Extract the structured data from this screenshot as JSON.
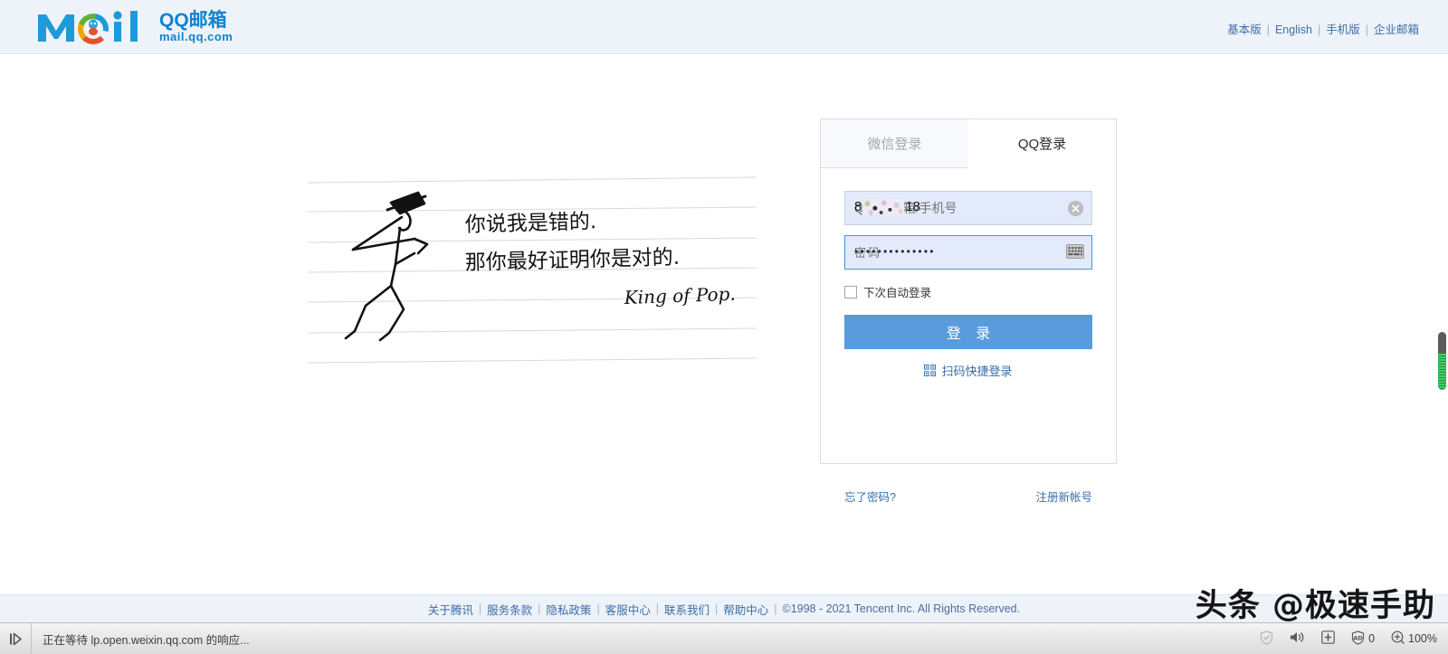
{
  "header": {
    "logo": {
      "brand_mark": "moil-logo",
      "title": "QQ邮箱",
      "subtitle": "mail.qq.com",
      "color": "#0e82d2"
    },
    "links": [
      {
        "label": "基本版",
        "name": "header-link-basic"
      },
      {
        "label": "English",
        "name": "header-link-english"
      },
      {
        "label": "手机版",
        "name": "header-link-mobile"
      },
      {
        "label": "企业邮箱",
        "name": "header-link-enterprise"
      }
    ],
    "separator": "|"
  },
  "illustration": {
    "line1": "你说我是错的.",
    "line2": "那你最好证明你是对的.",
    "signature": "King of Pop.",
    "alt": "handwritten-notebook-stick-figure"
  },
  "login": {
    "tabs": [
      {
        "label": "微信登录",
        "active": false,
        "name": "tab-wechat-login"
      },
      {
        "label": "QQ登录",
        "active": true,
        "name": "tab-qq-login"
      }
    ],
    "account": {
      "value_prefix": "8",
      "value_suffix": "18",
      "placeholder": "QQ号/邮箱/手机号",
      "masked": true,
      "clear_icon": "clear-circle-icon"
    },
    "password": {
      "value_dots": "••••••••••••••",
      "placeholder": "密码",
      "keyboard_icon": "soft-keyboard-icon",
      "focused": true,
      "border_color": "#4c8fd8"
    },
    "auto_login_label": "下次自动登录",
    "auto_login_checked": false,
    "submit_label": "登 录",
    "submit_color": "#5a9bdc",
    "qr_login_label": "扫码快捷登录",
    "qr_icon": "qrcode-icon",
    "forgot_password_label": "忘了密码?",
    "register_label": "注册新帐号"
  },
  "footer": {
    "links": [
      {
        "label": "关于腾讯",
        "name": "footer-link-about-tencent"
      },
      {
        "label": "服务条款",
        "name": "footer-link-terms"
      },
      {
        "label": "隐私政策",
        "name": "footer-link-privacy"
      },
      {
        "label": "客服中心",
        "name": "footer-link-support"
      },
      {
        "label": "联系我们",
        "name": "footer-link-contact"
      },
      {
        "label": "帮助中心",
        "name": "footer-link-help"
      }
    ],
    "separator": "|",
    "copyright": "©1998 - 2021 Tencent Inc. All Rights Reserved."
  },
  "watermark": {
    "text": "头条 @极速手助"
  },
  "statusbar": {
    "play_icon": "play-pause-icon",
    "status_text": "正在等待 lp.open.weixin.qq.com 的响应...",
    "right_items": [
      {
        "icon": "shield-icon",
        "label": "",
        "name": "statusbar-shield"
      },
      {
        "icon": "speaker-icon",
        "label": "",
        "name": "statusbar-speaker"
      },
      {
        "icon": "toolbox-icon",
        "label": "",
        "name": "statusbar-toolbox"
      },
      {
        "icon": "adblock-icon",
        "label": "0",
        "name": "statusbar-adblock"
      },
      {
        "icon": "zoom-icon",
        "label": "100%",
        "name": "statusbar-zoom"
      }
    ]
  }
}
